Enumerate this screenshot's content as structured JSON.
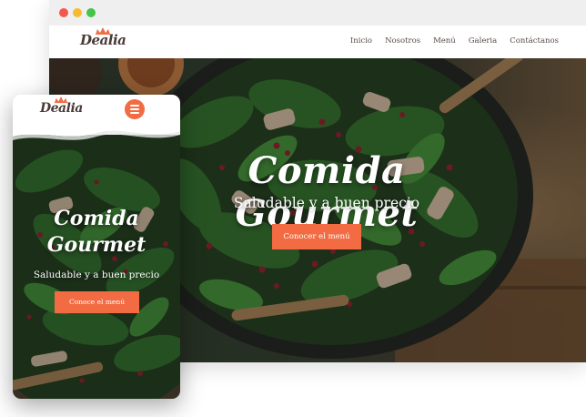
{
  "brand": {
    "name": "Dealia"
  },
  "desktop": {
    "nav": [
      "Inicio",
      "Nosotros",
      "Menú",
      "Galeria",
      "Contáctanos"
    ],
    "hero": {
      "title": "Comida Gourmet",
      "subtitle": "Saludable y a buen precio",
      "cta": "Conocer el menú"
    }
  },
  "mobile": {
    "hero": {
      "title_line1": "Comida",
      "title_line2": "Gourmet",
      "subtitle": "Saludable y a buen precio",
      "cta": "Conoce el menú"
    },
    "menu_icon": "hamburger-icon"
  },
  "colors": {
    "accent": "#f26b43",
    "brand_text": "#4a3a37",
    "hero_text": "#ffffff",
    "spinach": "#2f6b2a",
    "pomegranate": "#8c1d2c"
  }
}
